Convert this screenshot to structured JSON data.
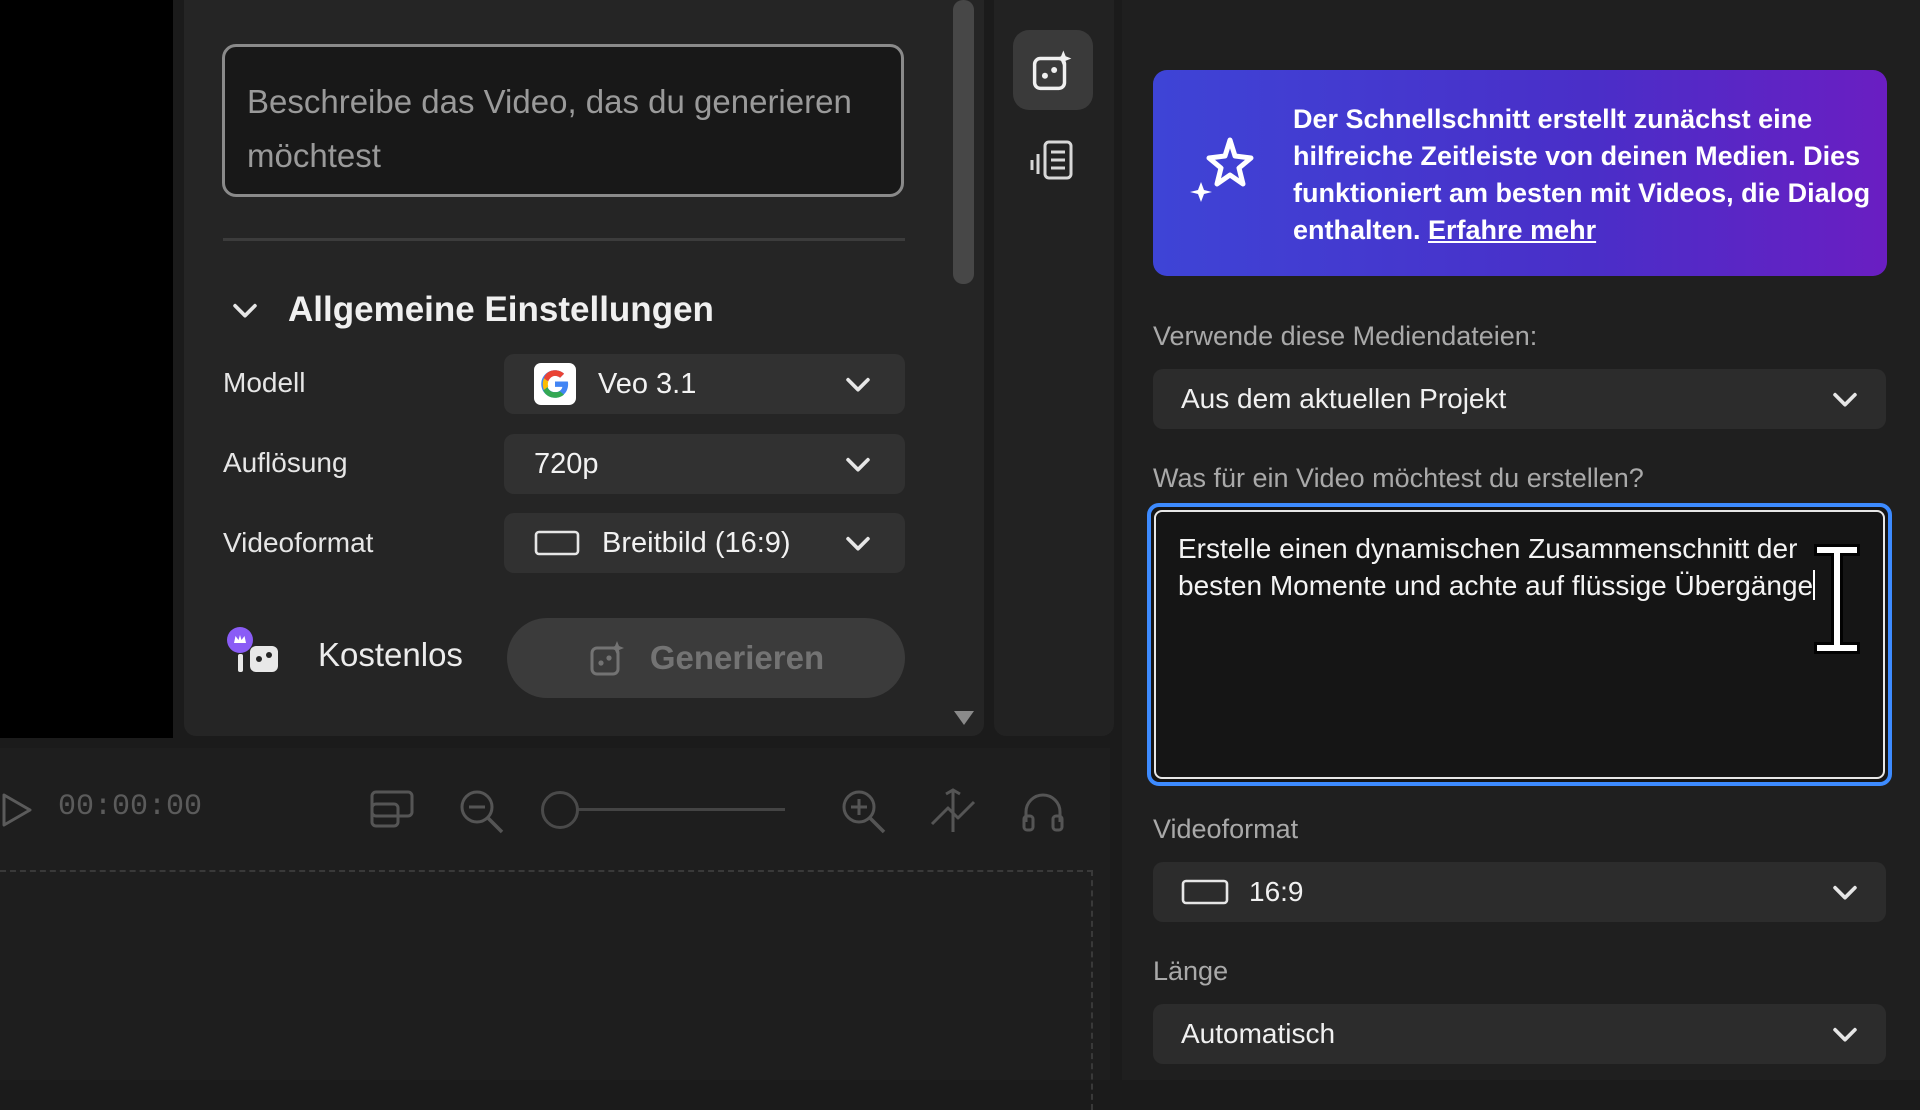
{
  "generate_panel": {
    "prompt_placeholder": "Beschreibe das Video, das du generieren möchtest",
    "settings_header": "Allgemeine Einstellungen",
    "rows": {
      "model": {
        "label": "Modell",
        "value": "Veo 3.1",
        "icon": "google-g-icon"
      },
      "resolution": {
        "label": "Auflösung",
        "value": "720p"
      },
      "format": {
        "label": "Videoformat",
        "value": "Breitbild (16:9)",
        "icon": "widescreen-icon"
      }
    },
    "free_label": "Kostenlos",
    "generate_label": "Generieren"
  },
  "timeline": {
    "timecode": "00:00:00"
  },
  "quick_cut": {
    "banner_text": "Der Schnellschnitt erstellt zunächst eine hilfreiche Zeitleiste von deinen Medien. Dies funktioniert am besten mit Videos, die Dialog enthalten.",
    "banner_link": "Erfahre mehr",
    "media_label": "Verwende diese Mediendateien:",
    "media_value": "Aus dem aktuellen Projekt",
    "prompt_label": "Was für ein Video möchtest du erstellen?",
    "prompt_value": "Erstelle einen dynamischen Zusammenschnitt der besten Momente und achte auf flüssige Übergänge",
    "format_label": "Videoformat",
    "format_value": "16:9",
    "length_label": "Länge",
    "length_value": "Automatisch"
  },
  "colors": {
    "accent_focus": "#3d8bff",
    "banner_gradient_start": "#3e44d6",
    "banner_gradient_end": "#6a1ec2",
    "panel_bg": "#252525"
  }
}
